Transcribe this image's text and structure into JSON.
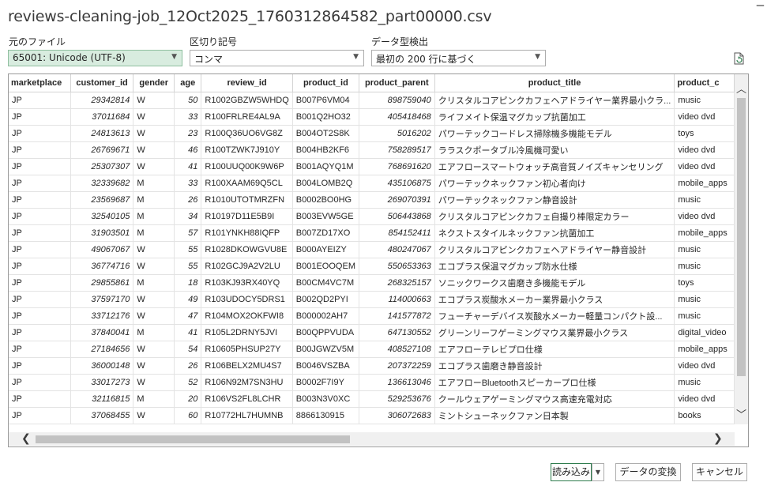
{
  "window": {
    "title": "reviews-cleaning-job_12Oct2025_1760312864582_part00000.csv"
  },
  "options": {
    "file_origin_label": "元のファイル",
    "file_origin_value": "65001: Unicode (UTF-8)",
    "delimiter_label": "区切り記号",
    "delimiter_value": "コンマ",
    "detection_label": "データ型検出",
    "detection_value": "最初の 200 行に基づく"
  },
  "table": {
    "columns": [
      "marketplace",
      "customer_id",
      "gender",
      "age",
      "review_id",
      "product_id",
      "product_parent",
      "product_title",
      "product_c"
    ],
    "rows": [
      [
        "JP",
        "29342814",
        "W",
        "50",
        "R1002GBZW5WHDQ",
        "B007P6VM04",
        "898759040",
        "クリスタルコアピンクカフェヘアドライヤー業界最小クラ...",
        "music"
      ],
      [
        "JP",
        "37011684",
        "W",
        "33",
        "R100FRLRE4AL9A",
        "B001Q2HO32",
        "405418468",
        "ライフメイト保温マグカップ抗菌加工",
        "video dvd"
      ],
      [
        "JP",
        "24813613",
        "W",
        "23",
        "R100Q36UO6VG8Z",
        "B004OT2S8K",
        "5016202",
        "パワーテックコードレス掃除機多機能モデル",
        "toys"
      ],
      [
        "JP",
        "26769671",
        "W",
        "46",
        "R100TZWK7J910Y",
        "B004HB2KF6",
        "758289517",
        "ララスクポータブル冷風機可愛い",
        "video dvd"
      ],
      [
        "JP",
        "25307307",
        "W",
        "41",
        "R100UUQ00K9W6P",
        "B001AQYQ1M",
        "768691620",
        "エアフロースマートウォッチ高音質ノイズキャンセリング",
        "video dvd"
      ],
      [
        "JP",
        "32339682",
        "M",
        "33",
        "R100XAAM69Q5CL",
        "B004LOMB2Q",
        "435106875",
        "パワーテックネックファン初心者向け",
        "mobile_apps"
      ],
      [
        "JP",
        "23569687",
        "M",
        "26",
        "R1010UTOTMRZFN",
        "B0002BO0HG",
        "269070391",
        "パワーテックネックファン静音設計",
        "music"
      ],
      [
        "JP",
        "32540105",
        "M",
        "34",
        "R10197D11E5B9I",
        "B003EVW5GE",
        "506443868",
        "クリスタルコアピンクカフェ自撮り棒限定カラー",
        "video dvd"
      ],
      [
        "JP",
        "31903501",
        "M",
        "57",
        "R101YNKH88IQFP",
        "B007ZD17XO",
        "854152411",
        "ネクストスタイルネックファン抗菌加工",
        "mobile_apps"
      ],
      [
        "JP",
        "49067067",
        "W",
        "55",
        "R1028DKOWGVU8E",
        "B000AYEIZY",
        "480247067",
        "クリスタルコアピンクカフェヘアドライヤー静音設計",
        "music"
      ],
      [
        "JP",
        "36774716",
        "W",
        "55",
        "R102GCJ9A2V2LU",
        "B001EOOQEM",
        "550653363",
        "エコプラス保温マグカップ防水仕様",
        "music"
      ],
      [
        "JP",
        "29855861",
        "M",
        "18",
        "R103KJ93RX40YQ",
        "B00CM4VC7M",
        "268325157",
        "ソニックワークス歯磨き多機能モデル",
        "toys"
      ],
      [
        "JP",
        "37597170",
        "W",
        "49",
        "R103UDOCY5DRS1",
        "B002QD2PYI",
        "114000663",
        "エコプラス炭酸水メーカー業界最小クラス",
        "music"
      ],
      [
        "JP",
        "33712176",
        "W",
        "47",
        "R104MOX2OKFWI8",
        "B000002AH7",
        "141577872",
        "フューチャーデバイス炭酸水メーカー軽量コンパクト設...",
        "music"
      ],
      [
        "JP",
        "37840041",
        "M",
        "41",
        "R105L2DRNY5JVI",
        "B00QPPVUDA",
        "647130552",
        "グリーンリーフゲーミングマウス業界最小クラス",
        "digital_video"
      ],
      [
        "JP",
        "27184656",
        "W",
        "54",
        "R10605PHSUP27Y",
        "B00JGWZV5M",
        "408527108",
        "エアフローテレビプロ仕様",
        "mobile_apps"
      ],
      [
        "JP",
        "36000148",
        "W",
        "26",
        "R106BELX2MU4S7",
        "B0046VSZBA",
        "207372259",
        "エコプラス歯磨き静音設計",
        "video dvd"
      ],
      [
        "JP",
        "33017273",
        "W",
        "52",
        "R106N92M7SN3HU",
        "B0002F7I9Y",
        "136613046",
        "エアフローBluetoothスピーカープロ仕様",
        "music"
      ],
      [
        "JP",
        "32116815",
        "M",
        "20",
        "R106VS2FL8LCHR",
        "B003N3V0XC",
        "529253676",
        "クールウェアゲーミングマウス高速充電対応",
        "video dvd"
      ],
      [
        "JP",
        "37068455",
        "W",
        "60",
        "R10772HL7HUMNB",
        "8866130915",
        "306072683",
        "ミントシューネックファン日本製",
        "books"
      ]
    ]
  },
  "buttons": {
    "load": "読み込み",
    "transform": "データの変換",
    "cancel": "キャンセル"
  },
  "icons": {
    "dropdown": "chevron-down-icon",
    "refresh": "refresh-document-icon",
    "scroll_up": "chevron-up-icon",
    "scroll_down": "chevron-down-icon",
    "scroll_left": "chevron-left-icon",
    "scroll_right": "chevron-right-icon"
  },
  "colors": {
    "selected_combo": "#d8ecdf",
    "primary_border": "#2f7d4e"
  }
}
